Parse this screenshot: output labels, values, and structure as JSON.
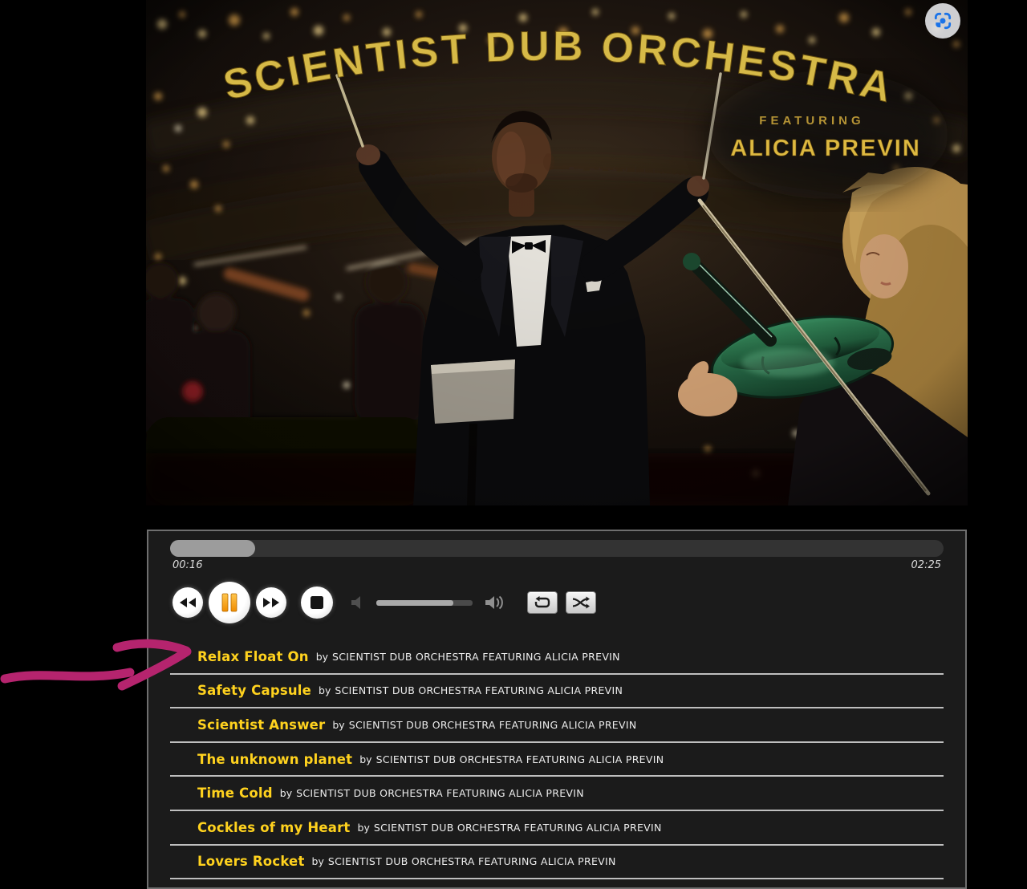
{
  "album_art": {
    "title": "SCIENTIST DUB ORCHESTRA",
    "featuring_label": "FEATURING",
    "featuring_artist": "ALICIA PREVIN",
    "title_color": "#dec04a"
  },
  "lens_button": {
    "icon": "google-lens-camera-icon",
    "circle_color": "#e9ebee",
    "glyph_color": "#1a73e8"
  },
  "player": {
    "elapsed": "00:16",
    "duration": "02:25",
    "progress_percent": 11,
    "volume_percent": 80,
    "state": "playing",
    "icons": {
      "rewind": "double-left-triangles-icon",
      "pause": "pause-bars-icon",
      "forward": "double-right-triangles-icon",
      "stop": "square-icon",
      "volume_min": "speaker-icon",
      "volume_max": "speaker-waves-icon",
      "loop": "repeat-loop-icon",
      "shuffle": "shuffle-arrows-icon"
    },
    "accent_pause_color": "#ffa818"
  },
  "playlist": {
    "by_label": "by",
    "artist": "SCIENTIST DUB ORCHESTRA FEATURING ALICIA PREVIN",
    "title_color": "#ffd21e",
    "tracks": [
      "Relax Float On",
      "Safety Capsule",
      "Scientist Answer",
      "The unknown planet",
      "Time Cold",
      "Cockles of my Heart",
      "Lovers Rocket"
    ]
  },
  "annotation": {
    "arrow_color": "#b5246e",
    "points_at": "Relax Float On"
  }
}
